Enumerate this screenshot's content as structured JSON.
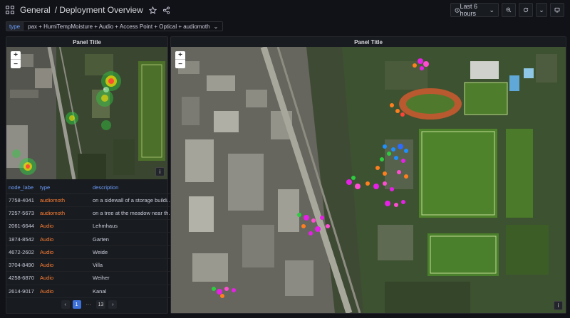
{
  "header": {
    "breadcrumb_root": "General",
    "breadcrumb_page": "/ Deployment Overview",
    "time_range": "Last 6 hours"
  },
  "variables": {
    "label": "type",
    "selected": "pax + HumiTempMoisture + Audio + Access Point + Optical + audiomoth"
  },
  "left_panel": {
    "title": "Panel Title"
  },
  "right_panel": {
    "title": "Panel Title"
  },
  "table": {
    "columns": [
      "node_labe",
      "type",
      "description"
    ],
    "rows": [
      [
        "7758-4041",
        "audiomoth",
        "on a sidewall of a storage buildi..."
      ],
      [
        "7257-5673",
        "audiomoth",
        "on a tree at the meadow near th..."
      ],
      [
        "2061-6644",
        "Audio",
        "Lehmhaus"
      ],
      [
        "1874-8542",
        "Audio",
        "Garten"
      ],
      [
        "4672-2602",
        "Audio",
        "Weide"
      ],
      [
        "3704-8490",
        "Audio",
        "Villa"
      ],
      [
        "4258-6870",
        "Audio",
        "Weiher"
      ],
      [
        "2614-9017",
        "Audio",
        "Kanal"
      ]
    ]
  },
  "pager": {
    "current": "1",
    "ellipsis": "···",
    "last": "13"
  },
  "colors": {
    "accent": "#3d71d9",
    "type_text": "#ff7f35",
    "header_text": "#6e9fff"
  }
}
